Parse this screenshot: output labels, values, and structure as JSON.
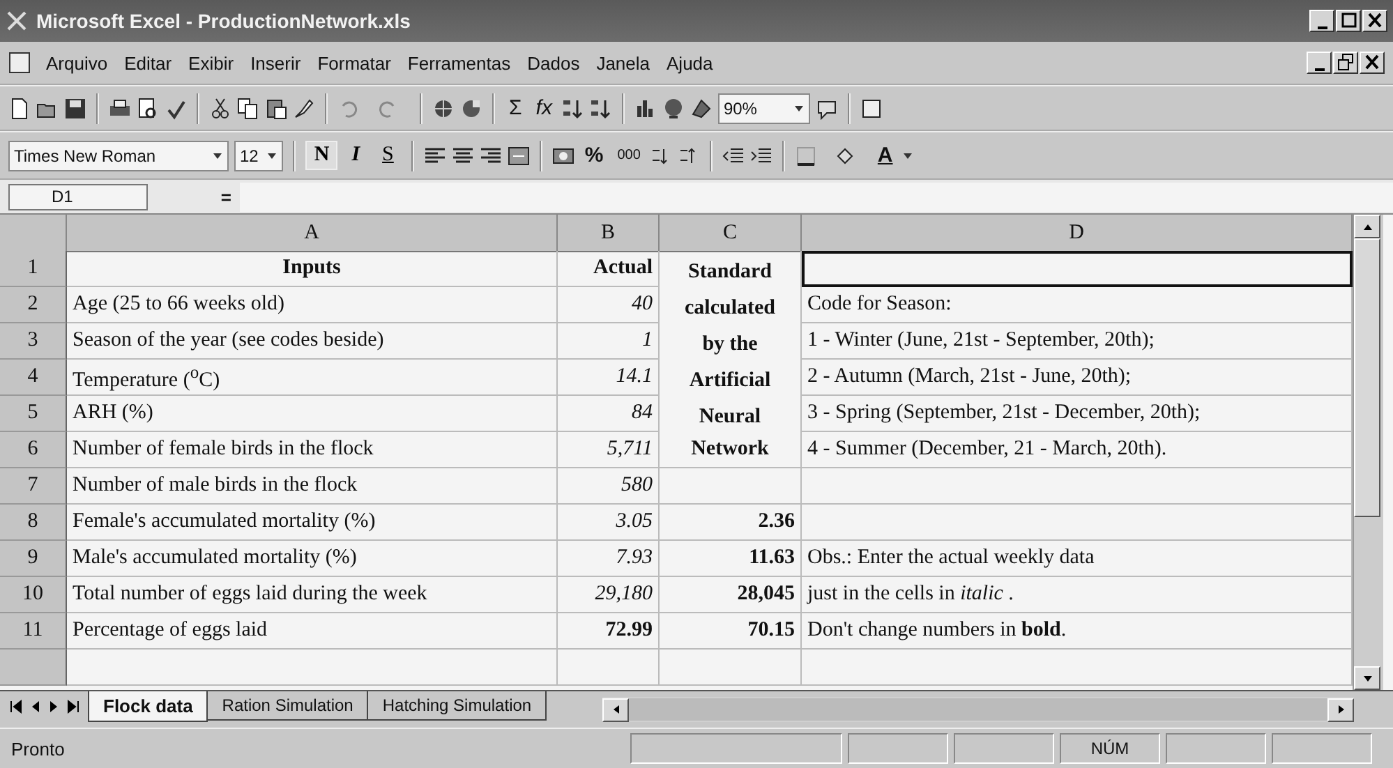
{
  "window": {
    "title": "Microsoft Excel - ProductionNetwork.xls"
  },
  "menu": [
    {
      "label": "Arquivo"
    },
    {
      "label": "Editar"
    },
    {
      "label": "Exibir"
    },
    {
      "label": "Inserir"
    },
    {
      "label": "Formatar"
    },
    {
      "label": "Ferramentas"
    },
    {
      "label": "Dados"
    },
    {
      "label": "Janela"
    },
    {
      "label": "Ajuda"
    }
  ],
  "standard_toolbar": {
    "sum": "Σ",
    "function": "fx",
    "zoom": "90%"
  },
  "formatting_toolbar": {
    "font": "Times New Roman",
    "size": "12",
    "bold": "N",
    "italic": "I",
    "underline": "S",
    "percent": "%",
    "thousands": "000",
    "font_color": "A"
  },
  "formula_bar": {
    "name_box": "D1",
    "equals": "="
  },
  "columns": [
    "A",
    "B",
    "C",
    "D"
  ],
  "rows": [
    {
      "number": "1",
      "kind": "header",
      "a": "Inputs",
      "b": "Actual",
      "b_bold": true,
      "c": "Standard",
      "c_heading": true,
      "d_selected": true
    },
    {
      "number": "2",
      "kind": "data",
      "a": "Age (25 to 66 weeks old)",
      "b": "40",
      "b_bold": false,
      "c": "calculated",
      "c_heading": true,
      "d": "Code for Season:",
      "d_selected": false
    },
    {
      "number": "3",
      "kind": "data",
      "a": "Season of the year (see codes beside)",
      "b": "1",
      "b_bold": false,
      "c": "by the",
      "c_heading": true,
      "d": "1 - Winter (June, 21st - September, 20th);",
      "d_selected": false
    },
    {
      "number": "4",
      "kind": "data",
      "a": "Temperature ($^{o}$C)",
      "b": "14.1",
      "b_bold": false,
      "c": "Artificial",
      "c_heading": true,
      "d": "2 - Autumn (March, 21st - June, 20th);",
      "d_selected": false
    },
    {
      "number": "5",
      "kind": "data",
      "a": "ARH (%)",
      "b": "84",
      "b_bold": false,
      "c": "Neural",
      "c_heading": true,
      "d": "3 - Spring (September, 21st - December, 20th);",
      "d_selected": false
    },
    {
      "number": "6",
      "kind": "data",
      "a": "Number of female birds in the flock",
      "b": "5,711",
      "b_bold": false,
      "c": "Network",
      "c_heading": true,
      "d": "4 - Summer (December, 21 - March, 20th).",
      "d_selected": false
    },
    {
      "number": "7",
      "kind": "data",
      "a": "Number of male birds in the flock",
      "b": "580",
      "b_bold": false,
      "d_selected": false
    },
    {
      "number": "8",
      "kind": "data",
      "a": "Female's accumulated mortality (%)",
      "b": "3.05",
      "b_bold": false,
      "c": "2.36",
      "c_heading": false,
      "d_selected": false
    },
    {
      "number": "9",
      "kind": "data",
      "a": "Male's accumulated mortality (%)",
      "b": "7.93",
      "b_bold": false,
      "c": "11.63",
      "c_heading": false,
      "d": "Obs.: Enter the actual weekly data",
      "d_selected": false
    },
    {
      "number": "10",
      "kind": "data",
      "a": "Total number of eggs laid during the week",
      "b": "29,180",
      "b_bold": false,
      "c": "28,045",
      "c_heading": false,
      "d": "just in the cells in *italic* .",
      "d_selected": false
    },
    {
      "number": "11",
      "kind": "data",
      "a": "Percentage of eggs laid",
      "b": "72.99",
      "b_bold": true,
      "c": "70.15",
      "c_heading": false,
      "d": "Don't change numbers in **bold**.",
      "d_selected": false
    }
  ],
  "sheet_tabs": [
    {
      "label": "Flock data",
      "selected": true
    },
    {
      "label": "Ration Simulation",
      "selected": false
    },
    {
      "label": "Hatching Simulation",
      "selected": false
    }
  ],
  "status_bar": {
    "message": "Pronto",
    "num_lock": "NÚM"
  }
}
